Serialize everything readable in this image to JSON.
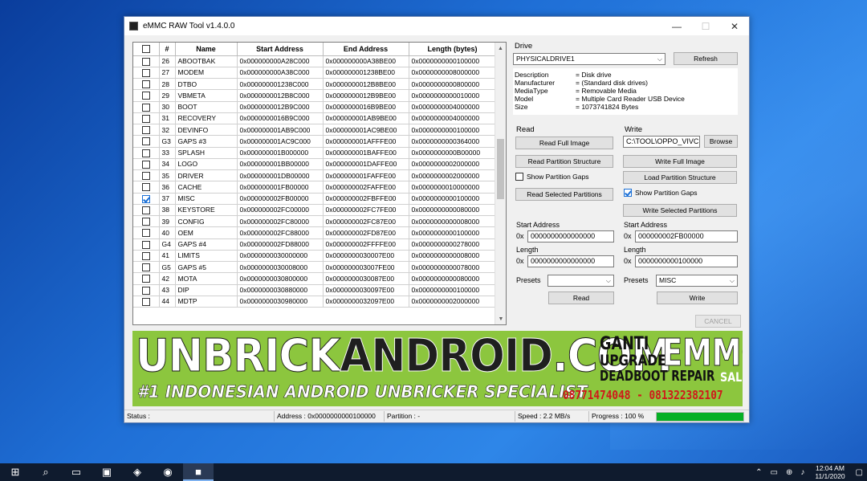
{
  "window": {
    "title": "eMMC RAW Tool v1.4.0.0",
    "minimize": "—",
    "maximize": "☐",
    "close": "✕"
  },
  "table": {
    "columns": [
      "",
      "#",
      "Name",
      "Start Address",
      "End Address",
      "Length (bytes)"
    ],
    "rows": [
      {
        "checked": false,
        "num": "26",
        "name": "ABOOTBAK",
        "start": "0x000000000A28C000",
        "end": "0x000000000A38BE00",
        "len": "0x0000000000100000"
      },
      {
        "checked": false,
        "num": "27",
        "name": "MODEM",
        "start": "0x000000000A38C000",
        "end": "0x000000001238BE00",
        "len": "0x0000000008000000"
      },
      {
        "checked": false,
        "num": "28",
        "name": "DTBO",
        "start": "0x000000001238C000",
        "end": "0x0000000012B8BE00",
        "len": "0x0000000000800000"
      },
      {
        "checked": false,
        "num": "29",
        "name": "VBMETA",
        "start": "0x0000000012B8C000",
        "end": "0x0000000012B9BE00",
        "len": "0x0000000000010000"
      },
      {
        "checked": false,
        "num": "30",
        "name": "BOOT",
        "start": "0x0000000012B9C000",
        "end": "0x0000000016B9BE00",
        "len": "0x0000000004000000"
      },
      {
        "checked": false,
        "num": "31",
        "name": "RECOVERY",
        "start": "0x0000000016B9C000",
        "end": "0x000000001AB9BE00",
        "len": "0x0000000004000000"
      },
      {
        "checked": false,
        "num": "32",
        "name": "DEVINFO",
        "start": "0x000000001AB9C000",
        "end": "0x000000001AC9BE00",
        "len": "0x0000000000100000"
      },
      {
        "checked": false,
        "num": "G3",
        "name": "GAPS #3",
        "start": "0x000000001AC9C000",
        "end": "0x000000001AFFFE00",
        "len": "0x0000000000364000"
      },
      {
        "checked": false,
        "num": "33",
        "name": "SPLASH",
        "start": "0x000000001B000000",
        "end": "0x000000001BAFFE00",
        "len": "0x0000000000B00000"
      },
      {
        "checked": false,
        "num": "34",
        "name": "LOGO",
        "start": "0x000000001BB00000",
        "end": "0x000000001DAFFE00",
        "len": "0x0000000002000000"
      },
      {
        "checked": false,
        "num": "35",
        "name": "DRIVER",
        "start": "0x000000001DB00000",
        "end": "0x000000001FAFFE00",
        "len": "0x0000000002000000"
      },
      {
        "checked": false,
        "num": "36",
        "name": "CACHE",
        "start": "0x000000001FB00000",
        "end": "0x000000002FAFFE00",
        "len": "0x0000000010000000"
      },
      {
        "checked": true,
        "num": "37",
        "name": "MISC",
        "start": "0x000000002FB00000",
        "end": "0x000000002FBFFE00",
        "len": "0x0000000000100000"
      },
      {
        "checked": false,
        "num": "38",
        "name": "KEYSTORE",
        "start": "0x000000002FC00000",
        "end": "0x000000002FC7FE00",
        "len": "0x0000000000080000"
      },
      {
        "checked": false,
        "num": "39",
        "name": "CONFIG",
        "start": "0x000000002FC80000",
        "end": "0x000000002FC87E00",
        "len": "0x0000000000008000"
      },
      {
        "checked": false,
        "num": "40",
        "name": "OEM",
        "start": "0x000000002FC88000",
        "end": "0x000000002FD87E00",
        "len": "0x0000000000100000"
      },
      {
        "checked": false,
        "num": "G4",
        "name": "GAPS #4",
        "start": "0x000000002FD88000",
        "end": "0x000000002FFFFE00",
        "len": "0x0000000000278000"
      },
      {
        "checked": false,
        "num": "41",
        "name": "LIMITS",
        "start": "0x0000000030000000",
        "end": "0x0000000030007E00",
        "len": "0x0000000000008000"
      },
      {
        "checked": false,
        "num": "G5",
        "name": "GAPS #5",
        "start": "0x0000000030008000",
        "end": "0x000000003007FE00",
        "len": "0x0000000000078000"
      },
      {
        "checked": false,
        "num": "42",
        "name": "MOTA",
        "start": "0x0000000030800000",
        "end": "0x0000000030087E00",
        "len": "0x0000000000080000"
      },
      {
        "checked": false,
        "num": "43",
        "name": "DIP",
        "start": "0x0000000030880000",
        "end": "0x0000000030097E00",
        "len": "0x0000000000100000"
      },
      {
        "checked": false,
        "num": "44",
        "name": "MDTP",
        "start": "0x0000000030980000",
        "end": "0x0000000032097E00",
        "len": "0x0000000002000000"
      }
    ]
  },
  "drive": {
    "label": "Drive",
    "selected": "PHYSICALDRIVE1",
    "refresh": "Refresh",
    "info": [
      {
        "k": "Description",
        "v": "= Disk drive"
      },
      {
        "k": "Manufacturer",
        "v": "= (Standard disk drives)"
      },
      {
        "k": "MediaType",
        "v": "= Removable Media"
      },
      {
        "k": "Model",
        "v": "= Multiple Card  Reader USB Device"
      },
      {
        "k": "Size",
        "v": "= 1073741824 Bytes"
      }
    ]
  },
  "read": {
    "label": "Read",
    "full_image": "Read Full Image",
    "partition_structure": "Read Partition Structure",
    "show_gaps": "Show Partition Gaps",
    "show_gaps_checked": false,
    "selected_partitions": "Read Selected Partitions",
    "start_label": "Start Address",
    "start_prefix": "0x",
    "start_value": "0000000000000000",
    "length_label": "Length",
    "length_prefix": "0x",
    "length_value": "0000000000000000",
    "presets_label": "Presets",
    "presets_value": "",
    "button": "Read"
  },
  "write": {
    "label": "Write",
    "path": "C:\\TOOL\\OPPO_VIVC",
    "browse": "Browse",
    "full_image": "Write Full Image",
    "load_structure": "Load Partition Structure",
    "show_gaps": "Show Partition Gaps",
    "show_gaps_checked": true,
    "selected_partitions": "Write Selected Partitions",
    "start_label": "Start Address",
    "start_prefix": "0x",
    "start_value": "000000002FB00000",
    "length_label": "Length",
    "length_prefix": "0x",
    "length_value": "0000000000100000",
    "presets_label": "Presets",
    "presets_value": "MISC",
    "button": "Write"
  },
  "cancel": "CANCEL",
  "banner": {
    "main_a": "UNBRICK",
    "main_b": "ANDROID",
    "main_c": ".COM",
    "sub": "#1 INDONESIAN ANDROID UNBRICKER SPECIALIST",
    "ganti": "GANTI",
    "upgrade": "UPGRADE",
    "emmc": "EMMC",
    "deadboot": "DEADBOOT REPAIR",
    "sale": "SALE",
    "phone": "08771474048 - 081322382107"
  },
  "status": {
    "status": "Status :",
    "address": "Address :  0x0000000000100000",
    "partition": "Partition :  -",
    "speed": "Speed :   2.2 MB/s",
    "progress": "Progress :   100 %",
    "progress_value": 100
  },
  "taskbar": {
    "time": "12:04 AM",
    "date": "11/1/2020"
  },
  "colors": {
    "banner_bg": "#8cc63e",
    "progress": "#06b025",
    "phone": "#d0181a"
  }
}
